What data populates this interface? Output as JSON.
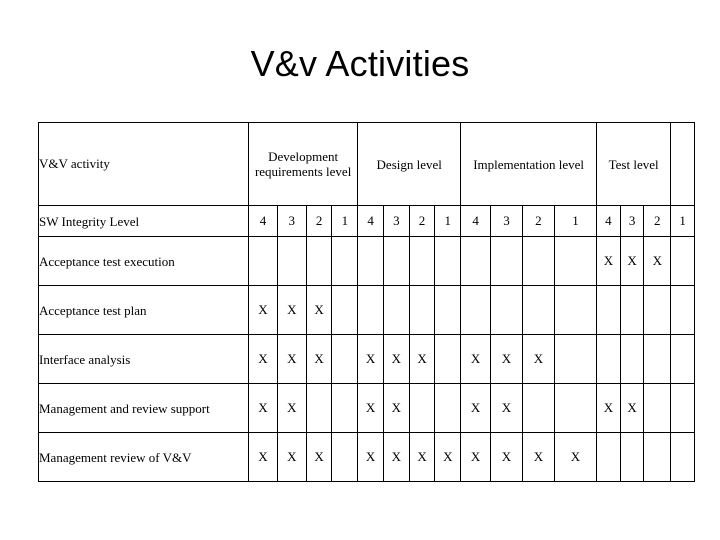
{
  "slide": {
    "title": "V&v Activities"
  },
  "table": {
    "activity_header": "V&V activity",
    "groups": [
      {
        "label": "Development requirements level",
        "levels": [
          "4",
          "3",
          "2",
          "1"
        ]
      },
      {
        "label": "Design level",
        "levels": [
          "4",
          "3",
          "2",
          "1"
        ]
      },
      {
        "label": "Implementation level",
        "levels": [
          "4",
          "3",
          "2",
          "1"
        ]
      },
      {
        "label": "Test level",
        "levels": [
          "4",
          "3",
          "2",
          "1"
        ]
      }
    ],
    "levels_row_label": "SW Integrity Level",
    "levels_row_values": [
      "4",
      "3",
      "2",
      "1",
      "4",
      "3",
      "2",
      "1",
      "4",
      "3",
      "2",
      "1",
      "4",
      "3",
      "2",
      "1"
    ],
    "mark": "X",
    "rows": [
      {
        "label": "Acceptance test execution",
        "cells": [
          "",
          "",
          "",
          "",
          "",
          "",
          "",
          "",
          "",
          "",
          "",
          "",
          "X",
          "X",
          "X",
          ""
        ]
      },
      {
        "label": "Acceptance test plan",
        "cells": [
          "X",
          "X",
          "X",
          "",
          "",
          "",
          "",
          "",
          "",
          "",
          "",
          "",
          "",
          "",
          "",
          ""
        ]
      },
      {
        "label": "Interface analysis",
        "cells": [
          "X",
          "X",
          "X",
          "",
          "X",
          "X",
          "X",
          "",
          "X",
          "X",
          "X",
          "",
          "",
          "",
          "",
          ""
        ]
      },
      {
        "label": "Management and review support",
        "cells": [
          "X",
          "X",
          "",
          "",
          "X",
          "X",
          "",
          "",
          "X",
          "X",
          "",
          "",
          "X",
          "X",
          "",
          ""
        ]
      },
      {
        "label": "Management review of V&V",
        "cells": [
          "X",
          "X",
          "X",
          "",
          "X",
          "X",
          "X",
          "X",
          "X",
          "X",
          "X",
          "X",
          "",
          "",
          "",
          ""
        ]
      }
    ]
  },
  "colors": {
    "background": "#ffffff",
    "text": "#000000",
    "border": "#000000"
  }
}
